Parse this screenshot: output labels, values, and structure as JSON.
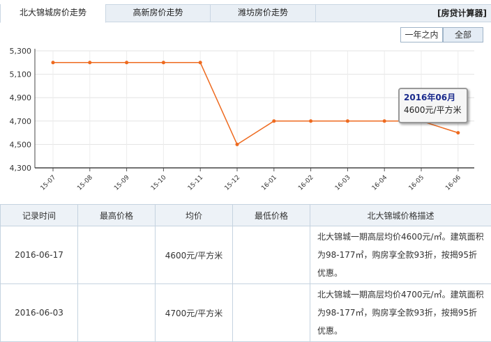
{
  "tabs": [
    {
      "label": "北大锦城房价走势",
      "active": true
    },
    {
      "label": "高新房价走势",
      "active": false
    },
    {
      "label": "潍坊房价走势",
      "active": false
    }
  ],
  "calculator_label": "[房贷计算器]",
  "range_buttons": [
    {
      "label": "一年之内",
      "selected": false
    },
    {
      "label": "全部",
      "selected": true
    }
  ],
  "chart_data": {
    "type": "line",
    "categories": [
      "15-07",
      "15-08",
      "15-09",
      "15-10",
      "15-11",
      "15-12",
      "16-01",
      "16-02",
      "16-03",
      "16-04",
      "16-05",
      "16-06"
    ],
    "series": [
      {
        "values": [
          5200,
          5200,
          5200,
          5200,
          5200,
          4500,
          4700,
          4700,
          4700,
          4700,
          4700,
          4600
        ]
      }
    ],
    "ylim": [
      4300,
      5300
    ],
    "yticks": [
      4300,
      4500,
      4700,
      4900,
      5100,
      5300
    ],
    "ytick_labels": [
      "4,300",
      "4,500",
      "4,700",
      "4,900",
      "5,100",
      "5,300"
    ],
    "grid": true,
    "line_color": "#ee6a1f",
    "tooltip": {
      "title": "2016年06月",
      "value": "4600元/平方米"
    }
  },
  "table": {
    "headers": [
      "记录时间",
      "最高价格",
      "均价",
      "最低价格",
      "北大锦城价格描述"
    ],
    "rows": [
      {
        "date": "2016-06-17",
        "max": "",
        "avg": "4600元/平方米",
        "min": "",
        "desc": "北大锦城一期高层均价4600元/㎡。建筑面积为98-177㎡，购房享全款93折，按揭95折优惠。"
      },
      {
        "date": "2016-06-03",
        "max": "",
        "avg": "4700元/平方米",
        "min": "",
        "desc": "北大锦城一期高层均价4700元/㎡。建筑面积为98-177㎡，购房享全款93折，按揭95折优惠。"
      }
    ]
  }
}
